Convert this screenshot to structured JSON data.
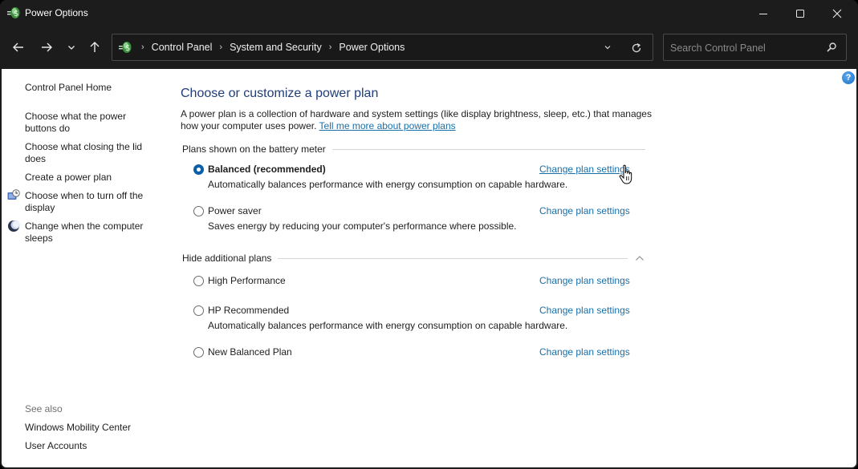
{
  "window": {
    "title": "Power Options",
    "controls": {
      "minimize": "minimize",
      "maximize": "maximize",
      "close": "close"
    }
  },
  "nav": {
    "breadcrumb": [
      "Control Panel",
      "System and Security",
      "Power Options"
    ],
    "search_placeholder": "Search Control Panel"
  },
  "sidebar": {
    "home": "Control Panel Home",
    "tasks": [
      {
        "label": "Choose what the power buttons do",
        "icon": null
      },
      {
        "label": "Choose what closing the lid does",
        "icon": null
      },
      {
        "label": "Create a power plan",
        "icon": null
      },
      {
        "label": "Choose when to turn off the display",
        "icon": "display-clock-icon"
      },
      {
        "label": "Change when the computer sleeps",
        "icon": "moon-sleep-icon"
      }
    ],
    "see_also_label": "See also",
    "see_also": [
      "Windows Mobility Center",
      "User Accounts"
    ]
  },
  "main": {
    "title": "Choose or customize a power plan",
    "intro": "A power plan is a collection of hardware and system settings (like display brightness, sleep, etc.) that manages how your computer uses power.",
    "intro_link": "Tell me more about power plans",
    "battery_group_label": "Plans shown on the battery meter",
    "additional_group_label": "Hide additional plans",
    "change_link_label": "Change plan settings",
    "plans": [
      {
        "name": "Balanced (recommended)",
        "description": "Automatically balances performance with energy consumption on capable hardware.",
        "selected": true,
        "group": "battery"
      },
      {
        "name": "Power saver",
        "description": "Saves energy by reducing your computer's performance where possible.",
        "selected": false,
        "group": "battery"
      },
      {
        "name": "High Performance",
        "description": "",
        "selected": false,
        "group": "additional"
      },
      {
        "name": "HP Recommended",
        "description": "Automatically balances performance with energy consumption on capable hardware.",
        "selected": false,
        "group": "additional"
      },
      {
        "name": "New Balanced Plan",
        "description": "",
        "selected": false,
        "group": "additional"
      }
    ]
  },
  "help": {
    "glyph": "?"
  },
  "colors": {
    "titlebar_bg": "#1c1c1c",
    "link": "#1a6fa8",
    "heading": "#1f3d7a",
    "radio_selected": "#0a5fa8"
  }
}
